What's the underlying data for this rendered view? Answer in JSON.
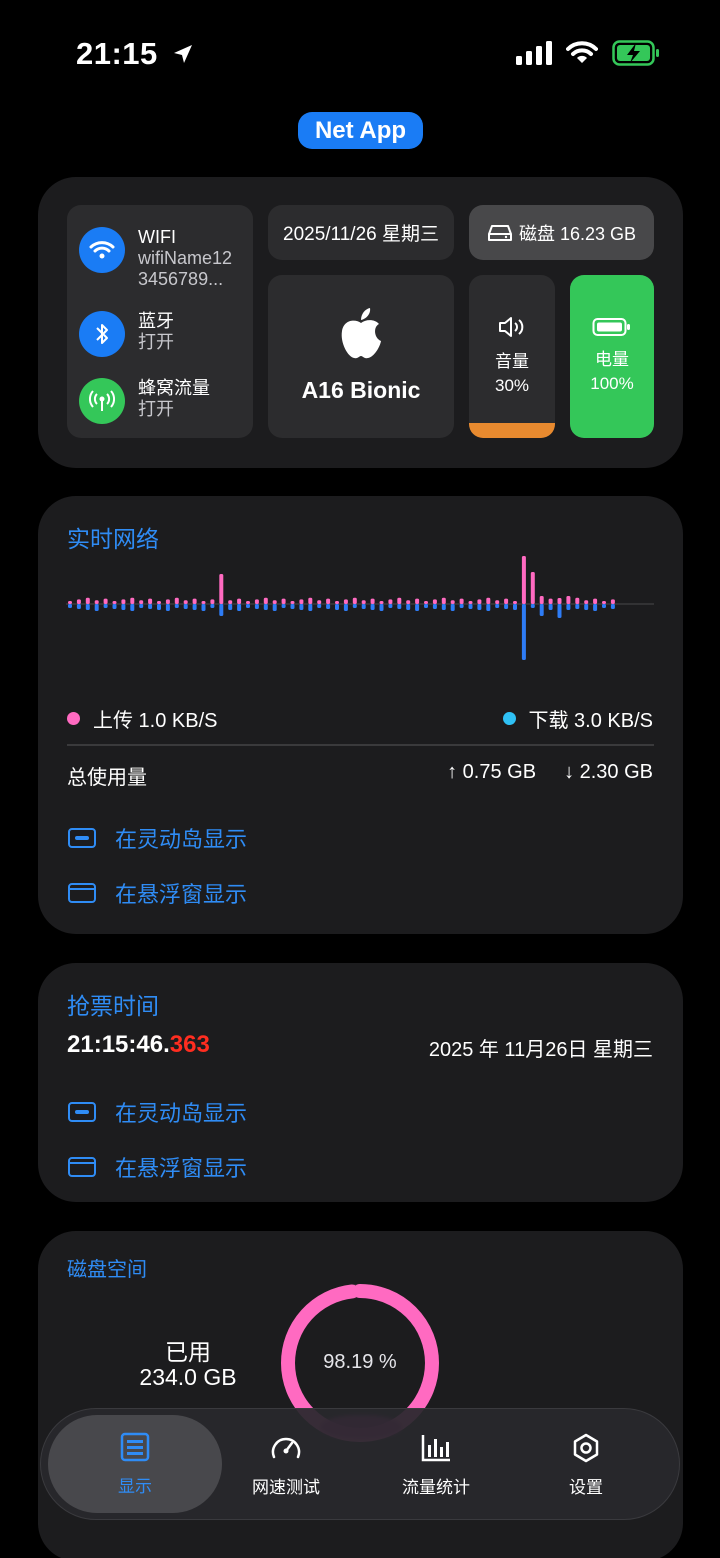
{
  "status_bar": {
    "time": "21:15"
  },
  "app_title": "Net App",
  "connections": {
    "wifi": {
      "title": "WIFI",
      "sub": "wifiName12 3456789..."
    },
    "bluetooth": {
      "title": "蓝牙",
      "sub": "打开"
    },
    "cellular": {
      "title": "蜂窝流量",
      "sub": "打开"
    }
  },
  "date_tile": "2025/11/26 星期三",
  "disk_tile": "磁盘 16.23 GB",
  "chip_tile": "A16 Bionic",
  "volume": {
    "label": "音量",
    "value": "30%",
    "level": 0.3
  },
  "battery": {
    "label": "电量",
    "value": "100%",
    "level": 1.0
  },
  "network": {
    "title": "实时网络",
    "upload_label": "上传 1.0 KB/S",
    "download_label": "下载 3.0 KB/S",
    "total_label": "总使用量",
    "total_up": "↑ 0.75 GB",
    "total_down": "↓ 2.30 GB",
    "action_island": "在灵动岛显示",
    "action_float": "在悬浮窗显示",
    "colors": {
      "upload": "#ff6ac1",
      "download": "#2e7cf6"
    }
  },
  "ticket": {
    "title": "抢票时间",
    "time_main": "21:15:46.",
    "time_ms": "363",
    "date": "2025 年 11月26日 星期三",
    "action_island": "在灵动岛显示",
    "action_float": "在悬浮窗显示"
  },
  "disk": {
    "title": "磁盘空间",
    "used_label": "已用",
    "used_value": "234.0 GB",
    "percent_label": "98.19 %",
    "percent": 98.19
  },
  "tabs": [
    {
      "label": "显示",
      "icon": "display-icon",
      "active": true
    },
    {
      "label": "网速测试",
      "icon": "speedometer-icon",
      "active": false
    },
    {
      "label": "流量统计",
      "icon": "chart-icon",
      "active": false
    },
    {
      "label": "设置",
      "icon": "settings-icon",
      "active": false
    }
  ]
}
